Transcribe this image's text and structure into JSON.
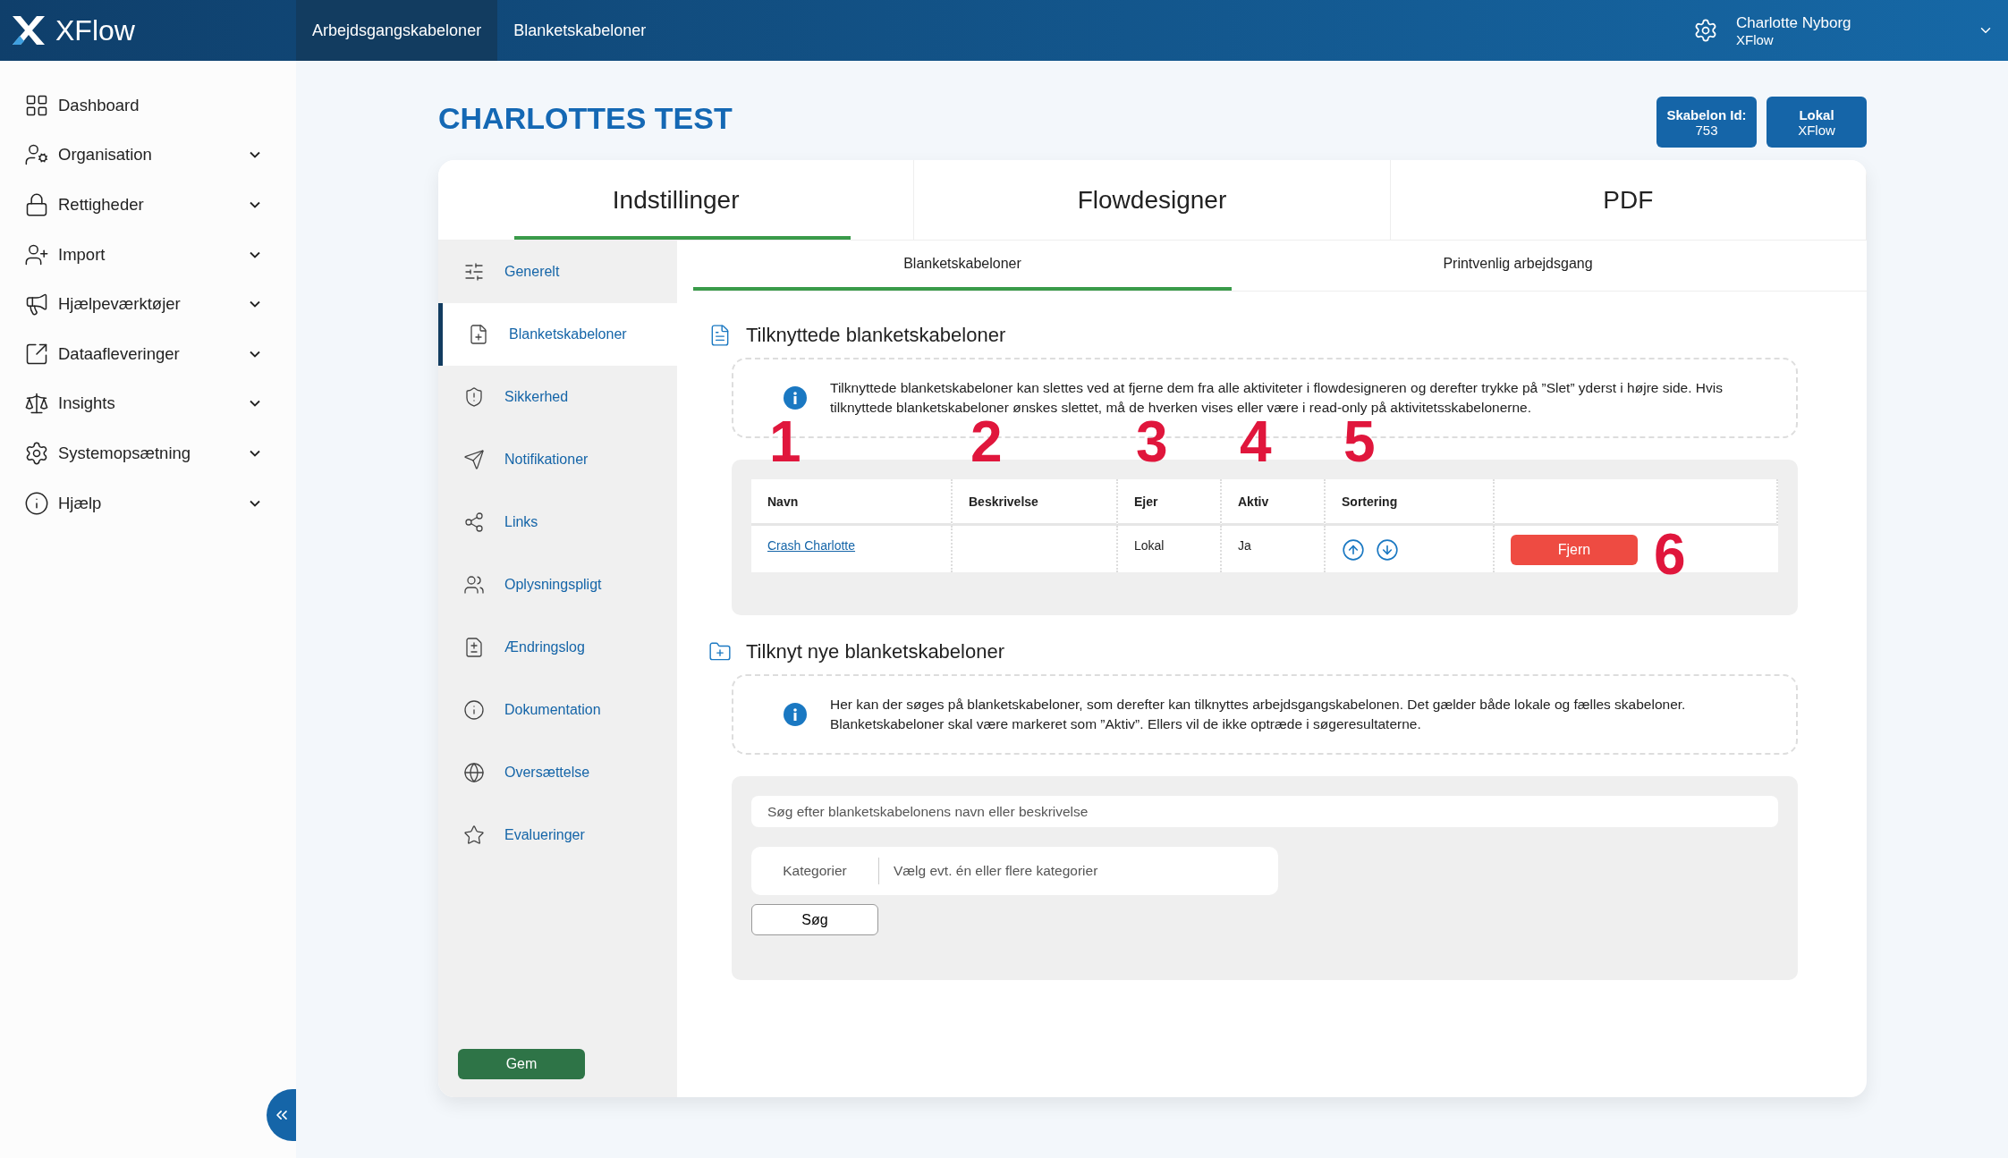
{
  "app": {
    "logo": "XFlow"
  },
  "top_nav": [
    {
      "label": "Arbejdsgangskabeloner",
      "selected": true
    },
    {
      "label": "Blanketskabeloner",
      "selected": false
    }
  ],
  "user": {
    "name": "Charlotte Nyborg",
    "org": "XFlow"
  },
  "sidebar": {
    "items": [
      {
        "label": "Dashboard",
        "expandable": false
      },
      {
        "label": "Organisation",
        "expandable": true
      },
      {
        "label": "Rettigheder",
        "expandable": true
      },
      {
        "label": "Import",
        "expandable": true
      },
      {
        "label": "Hjælpeværktøjer",
        "expandable": true
      },
      {
        "label": "Dataafleveringer",
        "expandable": true
      },
      {
        "label": "Insights",
        "expandable": true
      },
      {
        "label": "Systemopsætning",
        "expandable": true
      },
      {
        "label": "Hjælp",
        "expandable": true
      }
    ]
  },
  "page": {
    "title": "CHARLOTTES TEST",
    "badges": [
      {
        "label": "Skabelon Id:",
        "value": "753"
      },
      {
        "label": "Lokal",
        "value": "XFlow"
      }
    ]
  },
  "main_tabs": [
    {
      "label": "Indstillinger",
      "selected": true
    },
    {
      "label": "Flowdesigner",
      "selected": false
    },
    {
      "label": "PDF",
      "selected": false
    }
  ],
  "settings_menu": [
    {
      "label": "Generelt",
      "selected": false
    },
    {
      "label": "Blanketskabeloner",
      "selected": true
    },
    {
      "label": "Sikkerhed",
      "selected": false
    },
    {
      "label": "Notifikationer",
      "selected": false
    },
    {
      "label": "Links",
      "selected": false
    },
    {
      "label": "Oplysningspligt",
      "selected": false
    },
    {
      "label": "Ændringslog",
      "selected": false
    },
    {
      "label": "Dokumentation",
      "selected": false
    },
    {
      "label": "Oversættelse",
      "selected": false
    },
    {
      "label": "Evalueringer",
      "selected": false
    }
  ],
  "sub_tabs": [
    {
      "label": "Blanketskabeloner",
      "selected": true
    },
    {
      "label": "Printvenlig arbejdsgang",
      "selected": false
    }
  ],
  "linked_section": {
    "title": "Tilknyttede blanketskabeloner",
    "info": "Tilknyttede blanketskabeloner kan slettes ved at fjerne dem fra alle aktiviteter i flowdesigneren og derefter trykke på ”Slet” yderst i højre side. Hvis tilknyttede blanketskabeloner ønskes slettet, må de hverken vises eller være i read-only på aktivitetsskabelonerne.",
    "table": {
      "columns": [
        {
          "label": "Navn",
          "annotation": "1"
        },
        {
          "label": "Beskrivelse",
          "annotation": "2"
        },
        {
          "label": "Ejer",
          "annotation": "3"
        },
        {
          "label": "Aktiv",
          "annotation": "4"
        },
        {
          "label": "Sortering",
          "annotation": "5"
        }
      ],
      "rows": [
        {
          "name": "Crash Charlotte",
          "owner": "Lokal",
          "active": "Ja",
          "action": {
            "label": "Fjern",
            "annotation": "6"
          }
        }
      ]
    }
  },
  "new_section": {
    "title": "Tilknyt nye blanketskabeloner",
    "info": "Her kan der søges på blanketskabeloner, som derefter kan tilknyttes arbejdsgangskabelonen. Det gælder både lokale og fælles skabeloner. Blanketskabeloner skal være markeret som ”Aktiv”. Ellers vil de ikke optræde i søgeresultaterne.",
    "search": {
      "placeholder": "Søg efter blanketskabelonens navn eller beskrivelse"
    },
    "category": {
      "label": "Kategorier",
      "placeholder": "Vælg evt. én eller flere kategorier"
    },
    "button": "Søg"
  },
  "save_button": "Gem"
}
